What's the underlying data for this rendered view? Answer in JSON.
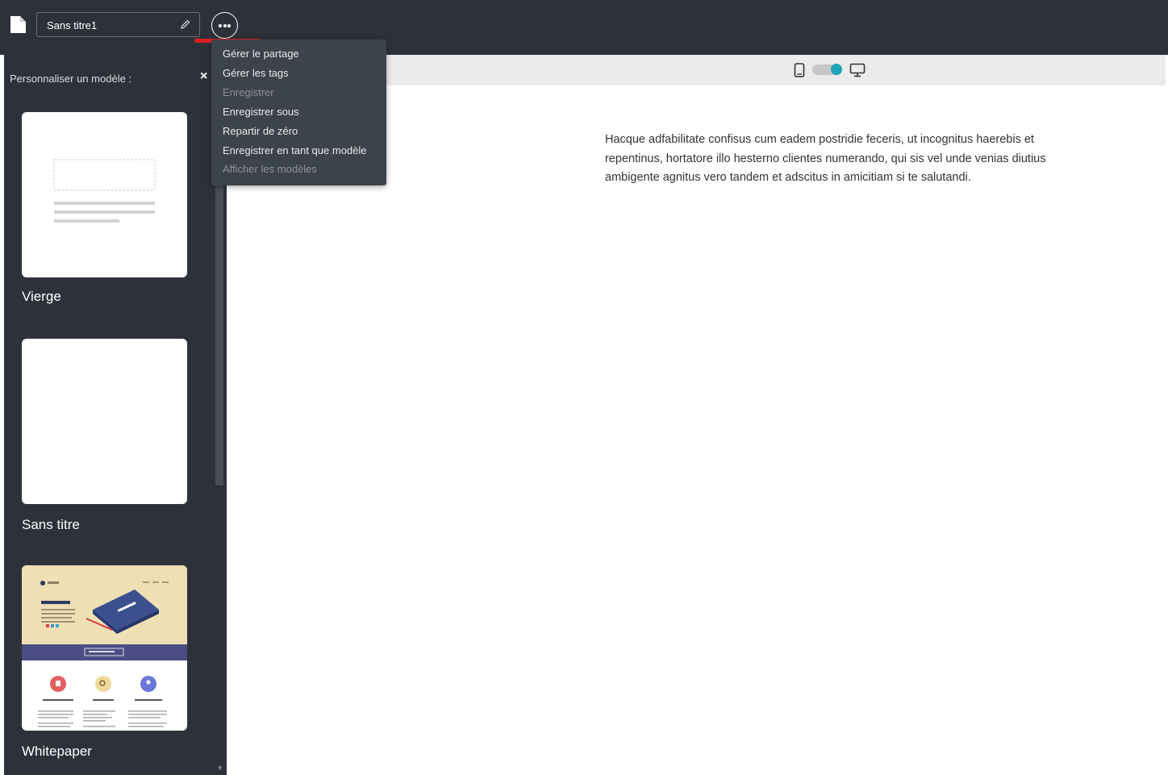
{
  "header": {
    "document_title": "Sans titre1"
  },
  "menu": {
    "items": [
      {
        "label": "Gérer le partage",
        "enabled": true
      },
      {
        "label": "Gérer les tags",
        "enabled": true
      },
      {
        "label": "Enregistrer",
        "enabled": false
      },
      {
        "label": "Enregistrer sous",
        "enabled": true
      },
      {
        "label": "Repartir de zéro",
        "enabled": true
      },
      {
        "label": "Enregistrer en tant que modèle",
        "enabled": true
      },
      {
        "label": "Afficher les modèles",
        "enabled": false
      }
    ]
  },
  "sidebar": {
    "title": "Personnaliser un modèle :",
    "close_icon": "×",
    "templates": [
      {
        "label": "Vierge"
      },
      {
        "label": "Sans titre"
      },
      {
        "label": "Whitepaper"
      }
    ]
  },
  "preview": {
    "device_toggle": "desktop",
    "paragraph": "Hacque adfabilitate confisus cum eadem postridie feceris, ut incognitus haerebis et repentinus, hortatore illo hesterno clientes numerando, qui sis vel unde venias diutius ambigente agnitus vero tandem et adscitus in amicitiam si te salutandi."
  },
  "colors": {
    "dark_bg": "#2d323a",
    "menu_bg": "#3d434b",
    "accent": "#1fa3b8",
    "highlight": "#e01e1e"
  }
}
